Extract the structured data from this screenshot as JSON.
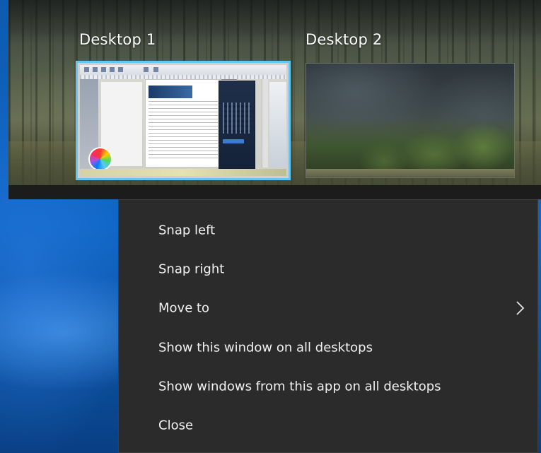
{
  "task_view": {
    "desktops": [
      {
        "label": "Desktop 1",
        "selected": true
      },
      {
        "label": "Desktop 2",
        "selected": false
      }
    ],
    "selection_color": "#66c6f2"
  },
  "context_menu": {
    "items": [
      {
        "label": "Snap left",
        "has_submenu": false
      },
      {
        "label": "Snap right",
        "has_submenu": false
      },
      {
        "label": "Move to",
        "has_submenu": true,
        "icon": "chevron-right-icon"
      },
      {
        "label": "Show this window on all desktops",
        "has_submenu": false
      },
      {
        "label": "Show windows from this app on all desktops",
        "has_submenu": false
      },
      {
        "label": "Close",
        "has_submenu": false
      }
    ],
    "background_color": "#2b2b2b",
    "text_color": "#f2f2f2"
  }
}
